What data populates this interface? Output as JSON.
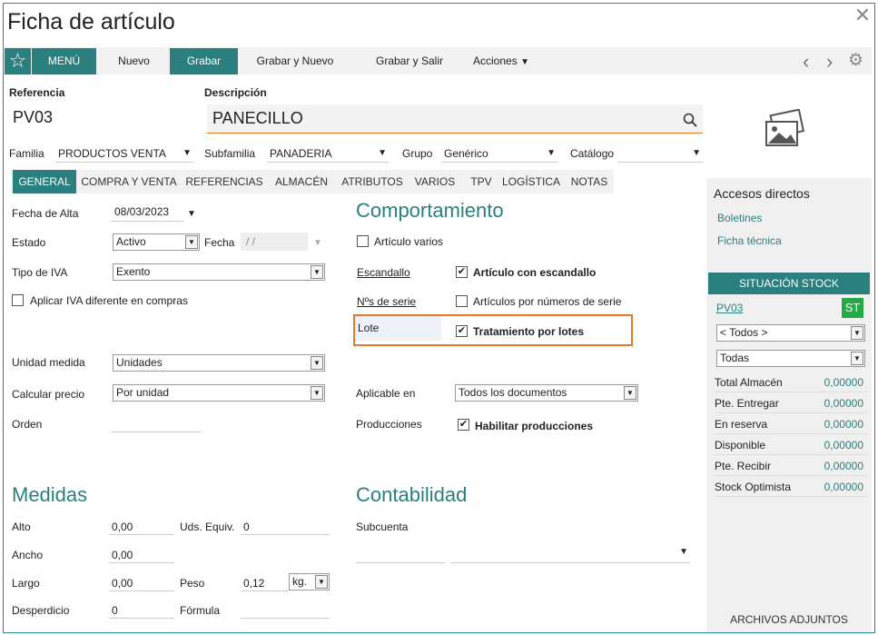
{
  "window": {
    "title": "Ficha de artículo"
  },
  "toolbar": {
    "menu": "MENÚ",
    "nuevo": "Nuevo",
    "grabar": "Grabar",
    "grabar_nuevo": "Grabar y Nuevo",
    "grabar_salir": "Grabar y Salir",
    "acciones": "Acciones"
  },
  "header": {
    "referencia_label": "Referencia",
    "referencia_value": "PV03",
    "descripcion_label": "Descripción",
    "descripcion_value": "PANECILLO",
    "familia_label": "Familia",
    "familia_value": "PRODUCTOS VENTA",
    "subfamilia_label": "Subfamilia",
    "subfamilia_value": "PANADERIA",
    "grupo_label": "Grupo",
    "grupo_value": "Genérico",
    "catalogo_label": "Catálogo",
    "catalogo_value": ""
  },
  "tabs": [
    "GENERAL",
    "COMPRA Y VENTA",
    "REFERENCIAS",
    "ALMACÉN",
    "ATRIBUTOS",
    "VARIOS",
    "TPV",
    "LOGÍSTICA",
    "NOTAS"
  ],
  "general": {
    "fecha_alta_label": "Fecha de Alta",
    "fecha_alta_value": "08/03/2023",
    "estado_label": "Estado",
    "estado_value": "Activo",
    "fecha_label": "Fecha",
    "fecha_value": "/ /",
    "tipo_iva_label": "Tipo de IVA",
    "tipo_iva_value": "Exento",
    "aplicar_iva_label": "Aplicar IVA diferente en compras",
    "unidad_label": "Unidad medida",
    "unidad_value": "Unidades",
    "calcular_label": "Calcular precio",
    "calcular_value": "Por unidad",
    "orden_label": "Orden",
    "orden_value": ""
  },
  "comportamiento": {
    "title": "Comportamiento",
    "articulo_varios": "Artículo varios",
    "escandallo_link": "Escandallo",
    "escandallo_check": "Artículo con escandallo",
    "nserie_link": "Nºs de serie",
    "nserie_check": "Artículos por números de serie",
    "lote_label": "Lote",
    "lote_check": "Tratamiento por lotes",
    "aplicable_label": "Aplicable en",
    "aplicable_value": "Todos los documentos",
    "producciones_label": "Producciones",
    "producciones_check": "Habilitar producciones"
  },
  "medidas": {
    "title": "Medidas",
    "alto_label": "Alto",
    "alto_value": "0,00",
    "uds_label": "Uds. Equiv.",
    "uds_value": "0",
    "ancho_label": "Ancho",
    "ancho_value": "0,00",
    "largo_label": "Largo",
    "largo_value": "0,00",
    "peso_label": "Peso",
    "peso_value": "0,12",
    "peso_unit": "kg.",
    "desperdicio_label": "Desperdicio",
    "desperdicio_value": "0",
    "formula_label": "Fórmula",
    "formula_value": ""
  },
  "contabilidad": {
    "title": "Contabilidad",
    "subcuenta_label": "Subcuenta"
  },
  "sidebar": {
    "accesos_title": "Accesos directos",
    "boletines": "Boletines",
    "ficha_tecnica": "Ficha técnica",
    "stock_title": "SITUACIÓN STOCK",
    "ref": "PV03",
    "badge": "ST",
    "filter1": "< Todos >",
    "filter2": "Todas",
    "rows": [
      {
        "label": "Total Almacén",
        "value": "0,00000"
      },
      {
        "label": "Pte. Entregar",
        "value": "0,00000"
      },
      {
        "label": "En reserva",
        "value": "0,00000"
      },
      {
        "label": "Disponible",
        "value": "0,00000"
      },
      {
        "label": "Pte. Recibir",
        "value": "0,00000"
      },
      {
        "label": "Stock Optimista",
        "value": "0,00000"
      }
    ],
    "adjuntos": "ARCHIVOS ADJUNTOS"
  },
  "colors": {
    "accent": "#2a7f7f",
    "highlight": "#e27a2a",
    "badge": "#22aa44"
  }
}
